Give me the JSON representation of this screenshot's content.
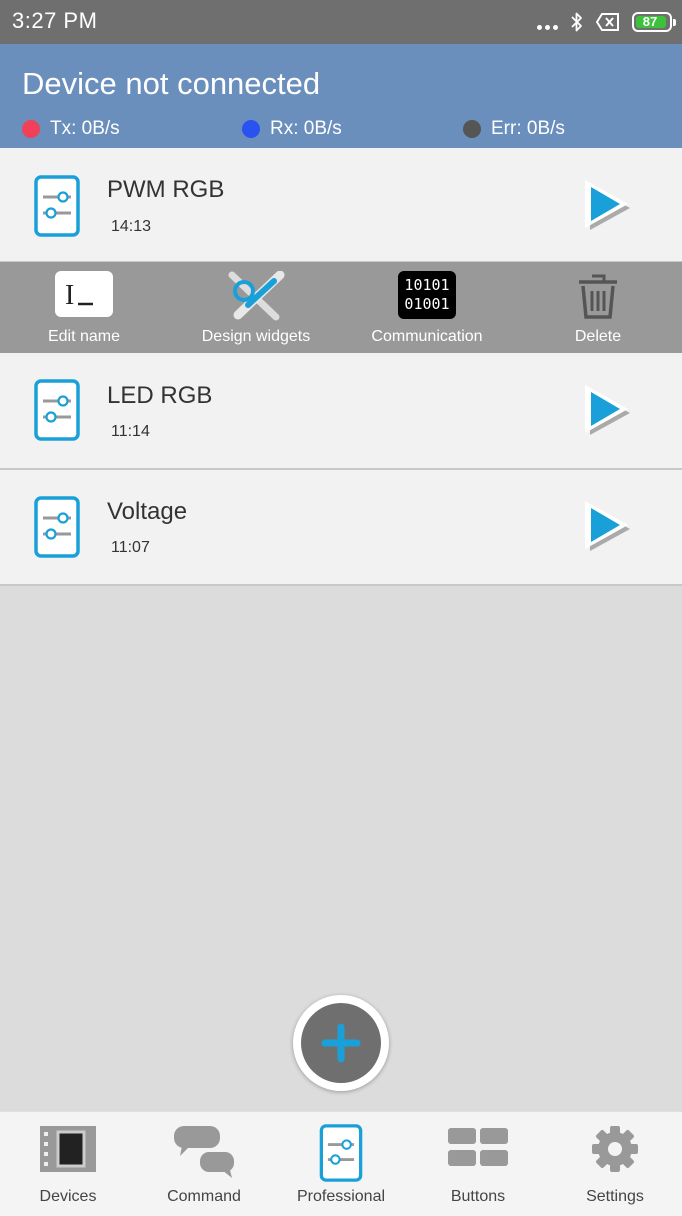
{
  "statusbar": {
    "time": "3:27 PM",
    "battery": "87"
  },
  "header": {
    "title": "Device not connected",
    "tx": "Tx: 0B/s",
    "rx": "Rx: 0B/s",
    "err": "Err: 0B/s",
    "colors": {
      "tx": "#f0405a",
      "rx": "#2a52f0",
      "err": "#555555"
    }
  },
  "items": [
    {
      "name": "PWM RGB",
      "time": "14:13"
    },
    {
      "name": "LED RGB",
      "time": "11:14"
    },
    {
      "name": "Voltage",
      "time": "11:07"
    }
  ],
  "actions": {
    "edit_name": "Edit name",
    "design_widgets": "Design widgets",
    "communication": "Communication",
    "communication_icon_text": [
      "10101",
      "01001"
    ],
    "delete": "Delete"
  },
  "nav": {
    "devices": "Devices",
    "command": "Command",
    "professional": "Professional",
    "buttons": "Buttons",
    "settings": "Settings"
  },
  "colors": {
    "accent": "#1aa0d8",
    "header_bg": "#6a8fbc",
    "action_bar": "#999999"
  }
}
